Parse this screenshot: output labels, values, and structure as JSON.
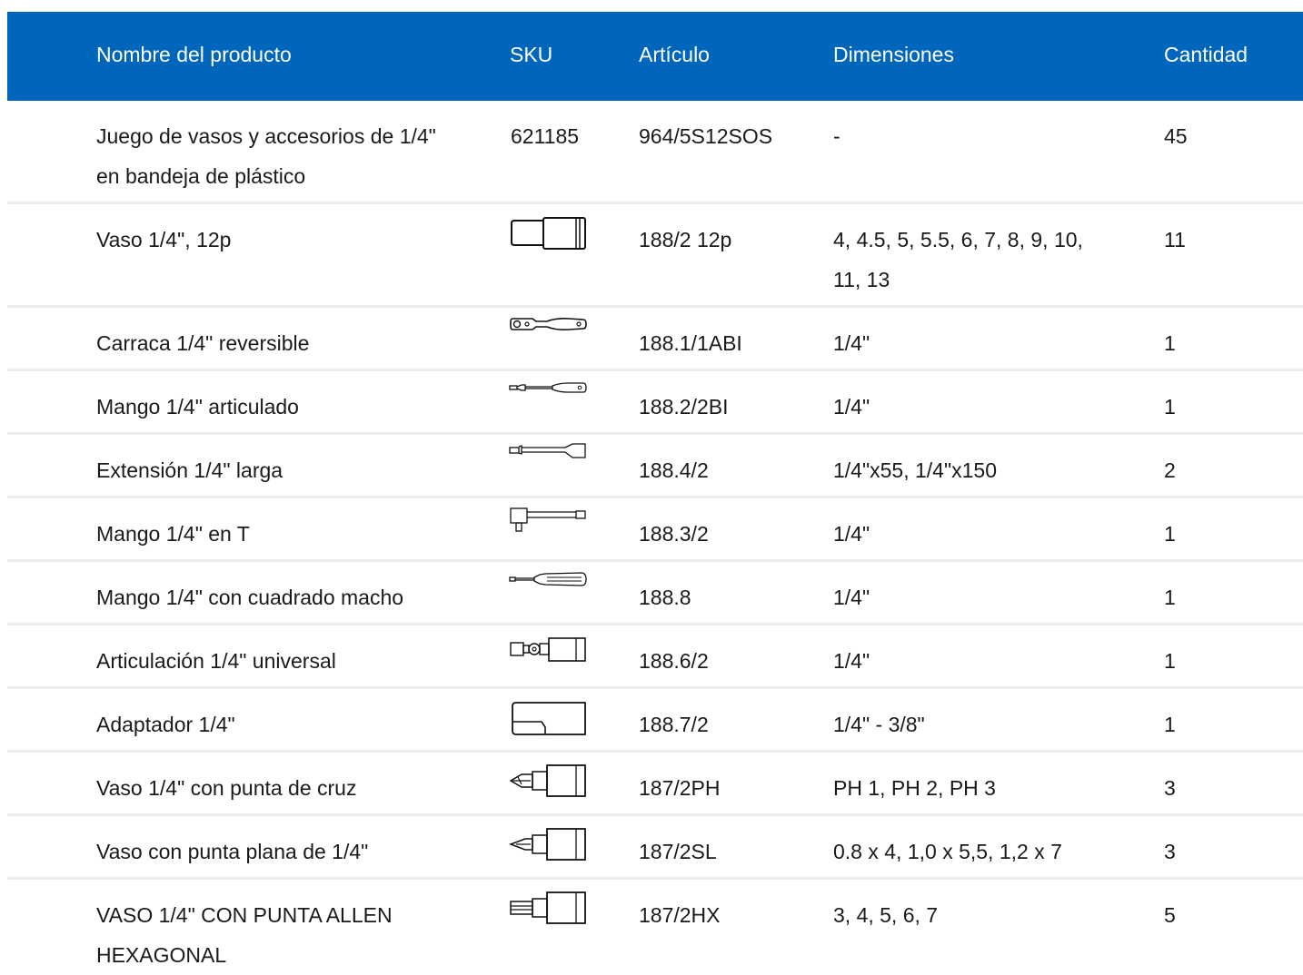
{
  "table": {
    "headers": {
      "name": "Nombre del producto",
      "sku": "SKU",
      "article": "Artículo",
      "dimensions": "Dimensiones",
      "quantity": "Cantidad"
    },
    "rows": [
      {
        "name_line1": "Juego de vasos y accesorios de 1/4\"",
        "name_line2": "en bandeja de plástico",
        "sku": "621185",
        "article": "964/5S12SOS",
        "dim_line1": "-",
        "dim_line2": "",
        "qty": "45"
      },
      {
        "name_line1": "Vaso 1/4\", 12p",
        "name_line2": "",
        "sku_icon": "socket-icon",
        "article": "188/2 12p",
        "dim_line1": "4, 4.5, 5, 5.5, 6, 7, 8, 9, 10,",
        "dim_line2": "11, 13",
        "qty": "11"
      },
      {
        "name_line1": "Carraca 1/4\" reversible",
        "name_line2": "",
        "sku_icon": "ratchet-icon",
        "article": "188.1/1ABI",
        "dim_line1": "1/4\"",
        "dim_line2": "",
        "qty": "1"
      },
      {
        "name_line1": "Mango 1/4\" articulado",
        "name_line2": "",
        "sku_icon": "hinged-handle-icon",
        "article": "188.2/2BI",
        "dim_line1": "1/4\"",
        "dim_line2": "",
        "qty": "1"
      },
      {
        "name_line1": "Extensión 1/4\" larga",
        "name_line2": "",
        "sku_icon": "extension-bar-icon",
        "article": "188.4/2",
        "dim_line1": "1/4\"x55, 1/4\"x150",
        "dim_line2": "",
        "qty": "2"
      },
      {
        "name_line1": "Mango 1/4\" en T",
        "name_line2": "",
        "sku_icon": "t-handle-icon",
        "article": "188.3/2",
        "dim_line1": "1/4\"",
        "dim_line2": "",
        "qty": "1"
      },
      {
        "name_line1": "Mango 1/4\" con cuadrado macho",
        "name_line2": "",
        "sku_icon": "screwdriver-handle-icon",
        "article": "188.8",
        "dim_line1": "1/4\"",
        "dim_line2": "",
        "qty": "1"
      },
      {
        "name_line1": "Articulación 1/4\" universal",
        "name_line2": "",
        "sku_icon": "universal-joint-icon",
        "article": "188.6/2",
        "dim_line1": "1/4\"",
        "dim_line2": "",
        "qty": "1"
      },
      {
        "name_line1": "Adaptador 1/4\"",
        "name_line2": "",
        "sku_icon": "adapter-icon",
        "article": "188.7/2",
        "dim_line1": "1/4\" - 3/8\"",
        "dim_line2": "",
        "qty": "1"
      },
      {
        "name_line1": "Vaso 1/4\" con punta de cruz",
        "name_line2": "",
        "sku_icon": "phillips-bit-socket-icon",
        "article": "187/2PH",
        "dim_line1": "PH 1, PH 2, PH 3",
        "dim_line2": "",
        "qty": "3"
      },
      {
        "name_line1": "Vaso con punta plana de 1/4\"",
        "name_line2": "",
        "sku_icon": "slotted-bit-socket-icon",
        "article": "187/2SL",
        "dim_line1": "0.8 x 4, 1,0 x 5,5, 1,2 x 7",
        "dim_line2": "",
        "qty": "3"
      },
      {
        "name_line1": "VASO 1/4\" CON PUNTA ALLEN",
        "name_line2": "HEXAGONAL",
        "sku_icon": "hex-bit-socket-icon",
        "article": "187/2HX",
        "dim_line1": "3, 4, 5, 6, 7",
        "dim_line2": "",
        "qty": "5"
      }
    ]
  }
}
